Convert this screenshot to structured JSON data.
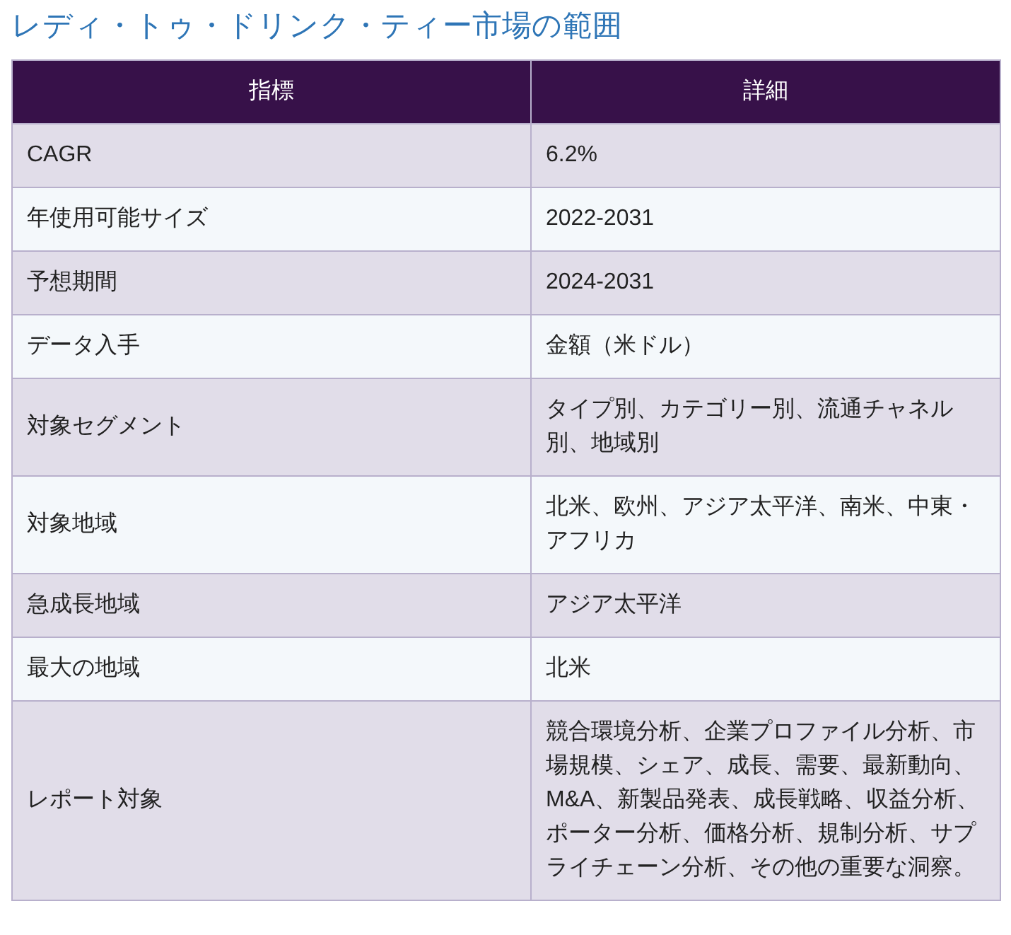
{
  "title": "レディ・トゥ・ドリンク・ティー市場の範囲",
  "table": {
    "columns": [
      "指標",
      "詳細"
    ],
    "rows": [
      [
        "CAGR",
        "6.2%"
      ],
      [
        "年使用可能サイズ",
        "2022-2031"
      ],
      [
        "予想期間",
        "2024-2031"
      ],
      [
        "データ入手",
        "金額（米ドル）"
      ],
      [
        "対象セグメント",
        "タイプ別、カテゴリー別、流通チャネル別、地域別"
      ],
      [
        "対象地域",
        "北米、欧州、アジア太平洋、南米、中東・アフリカ"
      ],
      [
        "急成長地域",
        "アジア太平洋"
      ],
      [
        "最大の地域",
        "北米"
      ],
      [
        "レポート対象",
        "競合環境分析、企業プロファイル分析、市場規模、シェア、成長、需要、最新動向、M&A、新製品発表、成長戦略、収益分析、ポーター分析、価格分析、規制分析、サプライチェーン分析、その他の重要な洞察。"
      ]
    ]
  }
}
